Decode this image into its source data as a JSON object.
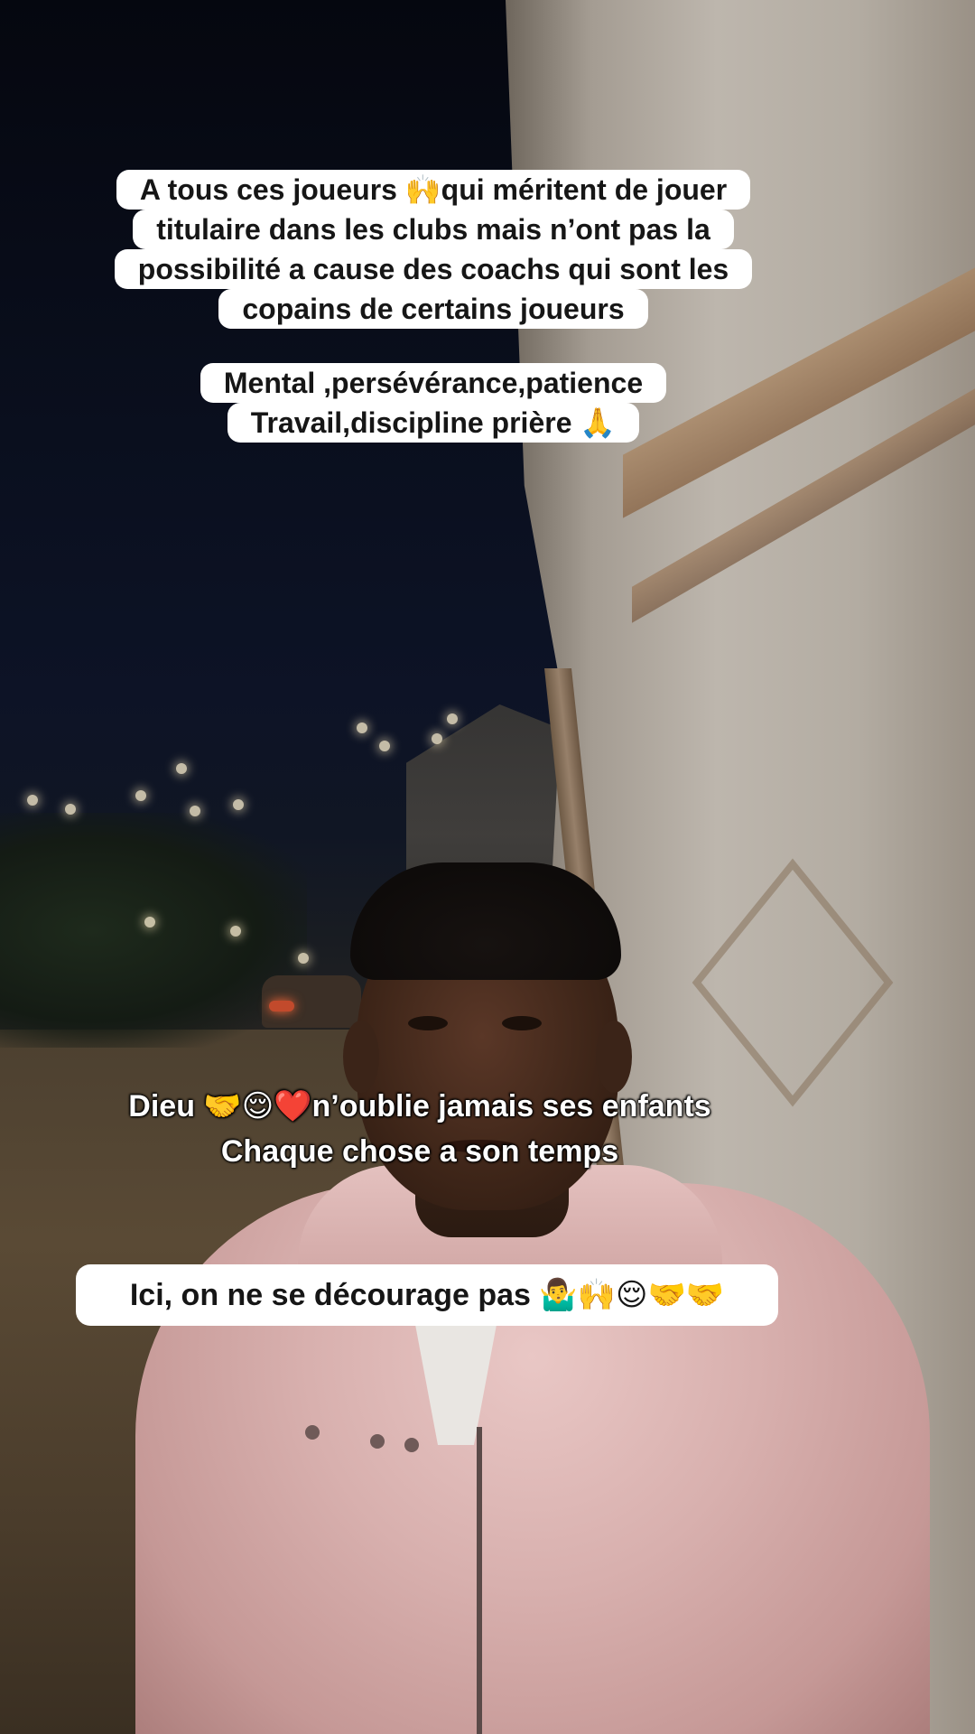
{
  "captions": {
    "top": {
      "lines": [
        "A tous ces joueurs 🙌qui méritent de jouer",
        "titulaire dans les clubs mais n’ont pas la",
        "possibilité a cause des coachs qui sont les",
        "copains de certains joueurs"
      ]
    },
    "values": {
      "lines": [
        "Mental ,persévérance,patience",
        "Travail,discipline prière 🙏"
      ]
    },
    "faith": {
      "lines": [
        "Dieu 🤝😌❤️n’oublie jamais ses enfants",
        "Chaque chose a son temps"
      ]
    },
    "bottom": {
      "text": "Ici, on ne se décourage pas 🤷‍♂️🙌😌🤝🤝"
    }
  },
  "colors": {
    "caption_bg": "#ffffff",
    "caption_text": "#161616",
    "overlay_text": "#ffffff",
    "jacket": "#d8b0ae"
  }
}
